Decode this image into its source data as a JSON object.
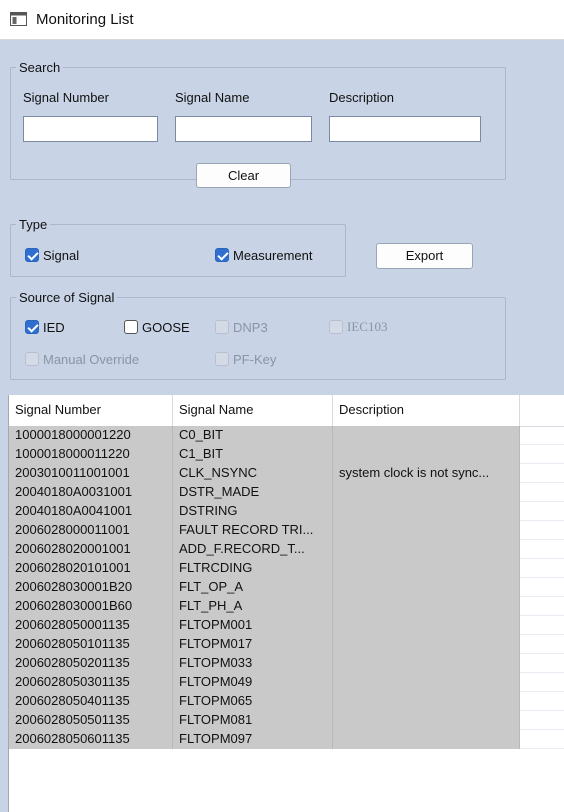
{
  "window": {
    "title": "Monitoring List",
    "icon": "app-window-icon"
  },
  "search": {
    "legend": "Search",
    "signal_number_label": "Signal Number",
    "signal_name_label": "Signal Name",
    "description_label": "Description",
    "signal_number_value": "",
    "signal_name_value": "",
    "description_value": "",
    "clear_label": "Clear"
  },
  "type": {
    "legend": "Type",
    "signal_label": "Signal",
    "signal_checked": true,
    "measurement_label": "Measurement",
    "measurement_checked": true
  },
  "export_label": "Export",
  "source": {
    "legend": "Source of Signal",
    "ied_label": "IED",
    "goose_label": "GOOSE",
    "dnp3_label": "DNP3",
    "iec103_label": "IEC103",
    "manual_override_label": "Manual Override",
    "pfkey_label": "PF-Key"
  },
  "table": {
    "columns": [
      "Signal Number",
      "Signal Name",
      "Description"
    ],
    "rows": [
      [
        "1000018000001220",
        "C0_BIT",
        ""
      ],
      [
        "1000018000011220",
        "C1_BIT",
        ""
      ],
      [
        "2003010011001001",
        "CLK_NSYNC",
        "system clock is not sync..."
      ],
      [
        "20040180A0031001",
        "DSTR_MADE",
        ""
      ],
      [
        "20040180A0041001",
        "DSTRING",
        ""
      ],
      [
        "2006028000011001",
        "FAULT RECORD TRI...",
        ""
      ],
      [
        "2006028020001001",
        "ADD_F.RECORD_T...",
        ""
      ],
      [
        "2006028020101001",
        "FLTRCDING",
        ""
      ],
      [
        "2006028030001B20",
        "FLT_OP_A",
        ""
      ],
      [
        "2006028030001B60",
        "FLT_PH_A",
        ""
      ],
      [
        "2006028050001135",
        "FLTOPM001",
        ""
      ],
      [
        "2006028050101135",
        "FLTOPM017",
        ""
      ],
      [
        "2006028050201135",
        "FLTOPM033",
        ""
      ],
      [
        "2006028050301135",
        "FLTOPM049",
        ""
      ],
      [
        "2006028050401135",
        "FLTOPM065",
        ""
      ],
      [
        "2006028050501135",
        "FLTOPM081",
        ""
      ],
      [
        "2006028050601135",
        "FLTOPM097",
        ""
      ]
    ]
  }
}
